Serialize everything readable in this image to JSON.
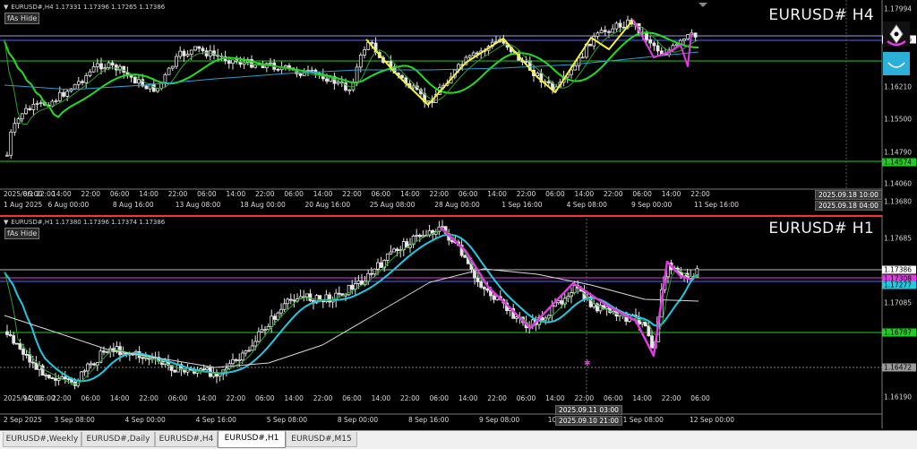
{
  "panels": {
    "h4": {
      "info": "EURUSD#,H4  1.17331 1.17396 1.17265 1.17386",
      "as_hide": "fAs Hide",
      "title": "EURUSD# H4",
      "time_labels": [
        "2025/8/1 22:00",
        "06:00",
        "14:00",
        "22:00",
        "06:00",
        "14:00",
        "22:00",
        "06:00",
        "14:00",
        "22:00",
        "06:00",
        "14:00",
        "22:00",
        "06:00",
        "14:00",
        "22:00",
        "06:00",
        "14:00",
        "22:00",
        "06:00",
        "14:00",
        "22:00",
        "06:00",
        "14:00",
        "22:00"
      ],
      "date_labels": [
        "1 Aug 2025",
        "6 Aug 00:00",
        "8 Aug 16:00",
        "13 Aug 08:00",
        "18 Aug 00:00",
        "20 Aug 16:00",
        "25 Aug 08:00",
        "28 Aug 00:00",
        "1 Sep 16:00",
        "4 Sep 08:00",
        "9 Sep 00:00",
        "11 Sep 16:00"
      ],
      "marker_time": "2025.09.18 10:00",
      "marker_date": "2025.09.18 04:00",
      "price_labels": [
        "1.17994",
        "1.16210",
        "1.15500",
        "1.14790",
        "1.14060",
        "1.13680"
      ],
      "price_tags": {
        "current": "1.17386",
        "green_line": "1.14574"
      }
    },
    "h1": {
      "info": "EURUSD#,H1  1.17380 1.17396 1.17374 1.17386",
      "as_hide": "fAs Hide",
      "title": "EURUSD# H1",
      "time_labels": [
        "2025/9/2 06:00",
        "14:00",
        "22:00",
        "06:00",
        "14:00",
        "22:00",
        "06:00",
        "14:00",
        "22:00",
        "06:00",
        "14:00",
        "22:00",
        "06:00",
        "14:00",
        "22:00",
        "06:00",
        "14:00",
        "22:00",
        "06:00",
        "14:00",
        "22:00",
        "06:00",
        "14:00",
        "22:00",
        "06:00"
      ],
      "date_labels": [
        "2 Sep 2025",
        "3 Sep 08:00",
        "4 Sep 00:00",
        "4 Sep 16:00",
        "5 Sep 08:00",
        "8 Sep 00:00",
        "8 Sep 16:00",
        "9 Sep 08:00",
        "10 Sep 00:00",
        "11 Sep 08:00",
        "12 Sep 00:00"
      ],
      "marker_time": "2025.09.11 03:00",
      "marker_date": "2025.09.10 21:00",
      "price_labels": [
        "1.17685",
        "1.17386",
        "1.17085",
        "1.16787",
        "1.16472",
        "1.16190"
      ],
      "price_tags": {
        "current": "1.17386",
        "magenta": "1.17308",
        "cyan": "1.17277",
        "green_line": "1.16787",
        "gray_line": "1.16472"
      }
    }
  },
  "tabs": [
    {
      "label": "EURUSD#,Weekly",
      "active": false
    },
    {
      "label": "EURUSD#,Daily",
      "active": false
    },
    {
      "label": "EURUSD#,H4",
      "active": false
    },
    {
      "label": "EURUSD#,H1",
      "active": true
    },
    {
      "label": "EURUSD#,M15",
      "active": false
    }
  ],
  "colors": {
    "background": "#000000",
    "candle": "#e6e6e6",
    "ma_green": "#22dd22",
    "ma_cyan": "#22c8e0",
    "ma_white": "#d8d8d8",
    "zigzag_yellow": "#f2f23a",
    "zigzag_magenta": "#e23ae2",
    "level_green": "#22cc22",
    "level_blue": "#4a6aff",
    "accent_red": "#ff3030"
  },
  "icons": [
    "pen-nib-icon",
    "cup-icon"
  ]
}
